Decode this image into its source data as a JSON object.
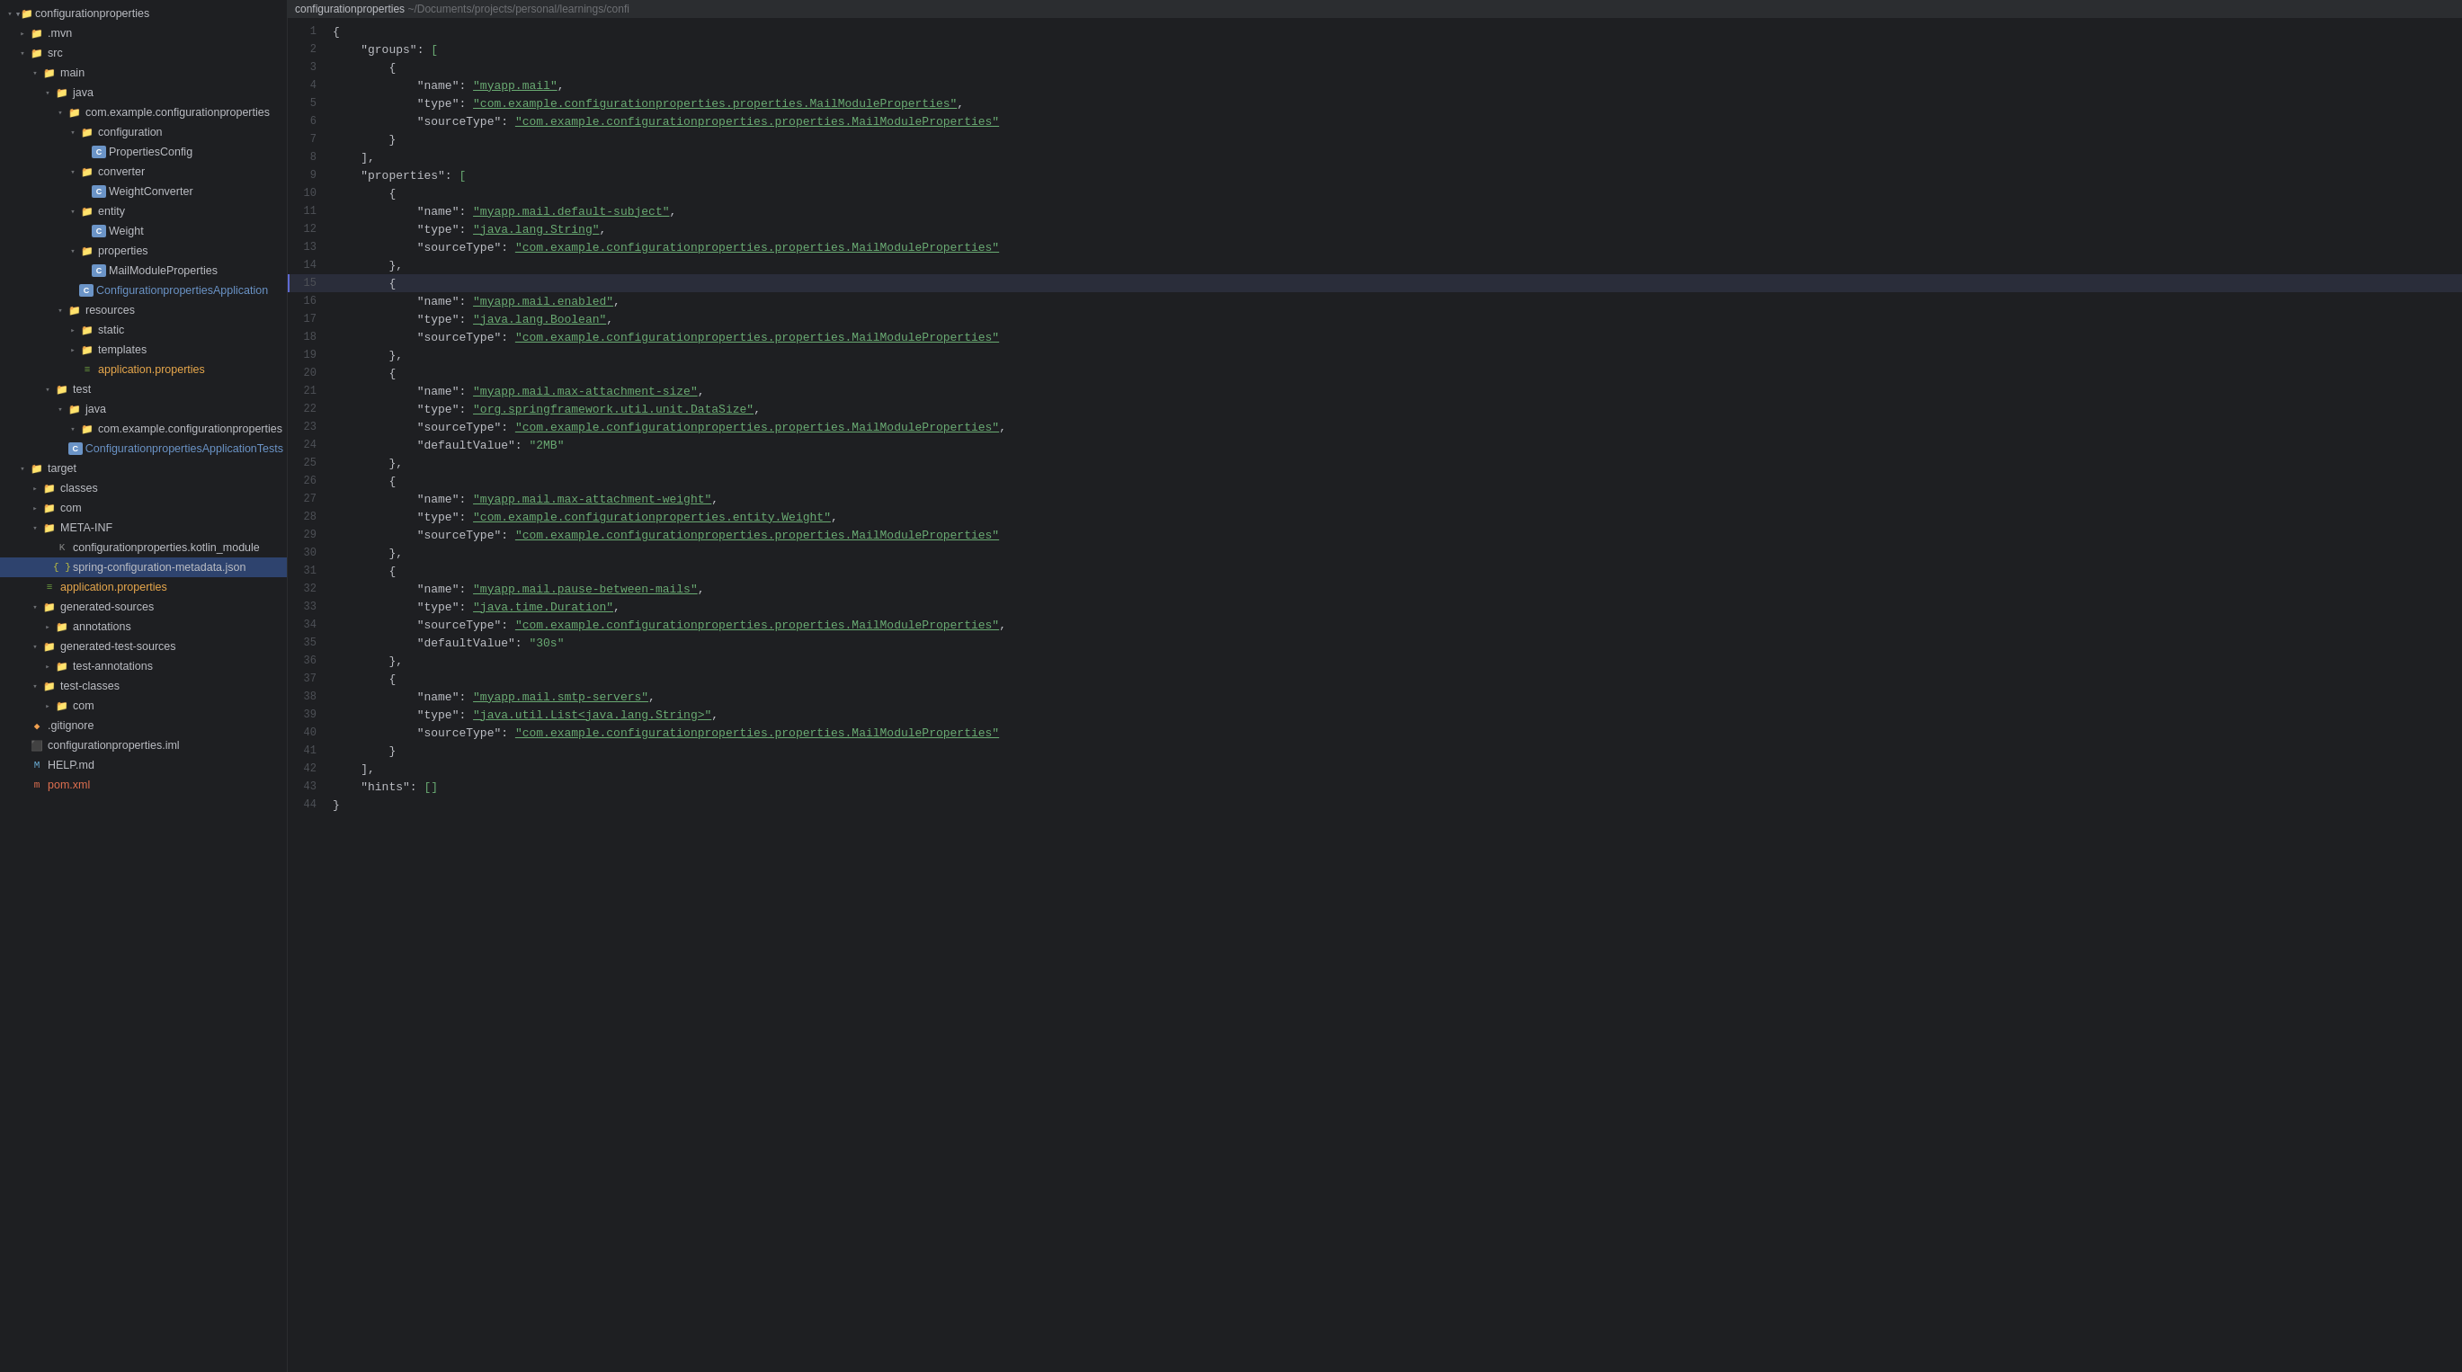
{
  "header": {
    "project_name": "configurationproperties",
    "path": " ~/Documents/projects/personal/learnings/confi"
  },
  "sidebar": {
    "items": [
      {
        "id": "root",
        "label": "configurationproperties",
        "type": "project-root",
        "indent": 0,
        "open": true,
        "icon": "folder"
      },
      {
        "id": "mvn",
        "label": ".mvn",
        "type": "folder",
        "indent": 1,
        "open": false,
        "icon": "folder"
      },
      {
        "id": "src",
        "label": "src",
        "type": "folder",
        "indent": 1,
        "open": true,
        "icon": "folder"
      },
      {
        "id": "main",
        "label": "main",
        "type": "folder",
        "indent": 2,
        "open": true,
        "icon": "folder"
      },
      {
        "id": "java",
        "label": "java",
        "type": "folder",
        "indent": 3,
        "open": true,
        "icon": "folder"
      },
      {
        "id": "com.example",
        "label": "com.example.configurationproperties",
        "type": "folder",
        "indent": 4,
        "open": true,
        "icon": "folder"
      },
      {
        "id": "configuration",
        "label": "configuration",
        "type": "folder",
        "indent": 5,
        "open": true,
        "icon": "folder"
      },
      {
        "id": "PropertiesConfig",
        "label": "PropertiesConfig",
        "type": "class",
        "indent": 6,
        "icon": "class"
      },
      {
        "id": "converter",
        "label": "converter",
        "type": "folder",
        "indent": 5,
        "open": true,
        "icon": "folder"
      },
      {
        "id": "WeightConverter",
        "label": "WeightConverter",
        "type": "class",
        "indent": 6,
        "icon": "class"
      },
      {
        "id": "entity",
        "label": "entity",
        "type": "folder",
        "indent": 5,
        "open": true,
        "icon": "folder"
      },
      {
        "id": "Weight",
        "label": "Weight",
        "type": "class",
        "indent": 6,
        "icon": "class"
      },
      {
        "id": "properties",
        "label": "properties",
        "type": "folder",
        "indent": 5,
        "open": true,
        "icon": "folder"
      },
      {
        "id": "MailModuleProperties",
        "label": "MailModuleProperties",
        "type": "class",
        "indent": 6,
        "icon": "class"
      },
      {
        "id": "ConfigApp",
        "label": "ConfigurationpropertiesApplication",
        "type": "class-main",
        "indent": 5,
        "icon": "class-main"
      },
      {
        "id": "resources",
        "label": "resources",
        "type": "folder",
        "indent": 4,
        "open": true,
        "icon": "folder"
      },
      {
        "id": "static",
        "label": "static",
        "type": "folder",
        "indent": 5,
        "open": false,
        "icon": "folder"
      },
      {
        "id": "templates",
        "label": "templates",
        "type": "folder",
        "indent": 5,
        "open": false,
        "icon": "folder"
      },
      {
        "id": "app-props",
        "label": "application.properties",
        "type": "properties",
        "indent": 5,
        "icon": "properties"
      },
      {
        "id": "test",
        "label": "test",
        "type": "folder",
        "indent": 3,
        "open": true,
        "icon": "folder"
      },
      {
        "id": "java-test",
        "label": "java",
        "type": "folder",
        "indent": 4,
        "open": true,
        "icon": "folder"
      },
      {
        "id": "com.example.test",
        "label": "com.example.configurationproperties",
        "type": "folder",
        "indent": 5,
        "open": true,
        "icon": "folder"
      },
      {
        "id": "AppTests",
        "label": "ConfigurationpropertiesApplicationTests",
        "type": "class-test",
        "indent": 6,
        "icon": "class-test"
      },
      {
        "id": "target",
        "label": "target",
        "type": "folder",
        "indent": 1,
        "open": true,
        "icon": "folder"
      },
      {
        "id": "classes",
        "label": "classes",
        "type": "folder",
        "indent": 2,
        "open": false,
        "icon": "folder"
      },
      {
        "id": "com-target",
        "label": "com",
        "type": "folder",
        "indent": 2,
        "open": false,
        "icon": "folder"
      },
      {
        "id": "META-INF",
        "label": "META-INF",
        "type": "folder",
        "indent": 2,
        "open": true,
        "icon": "folder"
      },
      {
        "id": "kotlin_module",
        "label": "configurationproperties.kotlin_module",
        "type": "kotlin",
        "indent": 3,
        "icon": "kotlin"
      },
      {
        "id": "spring-metadata",
        "label": "spring-configuration-metadata.json",
        "type": "json",
        "indent": 3,
        "icon": "json",
        "selected": true
      },
      {
        "id": "app-props2",
        "label": "application.properties",
        "type": "properties",
        "indent": 2,
        "icon": "properties"
      },
      {
        "id": "generated-sources",
        "label": "generated-sources",
        "type": "folder",
        "indent": 2,
        "open": true,
        "icon": "folder"
      },
      {
        "id": "annotations",
        "label": "annotations",
        "type": "folder",
        "indent": 3,
        "open": false,
        "icon": "folder"
      },
      {
        "id": "generated-test-sources",
        "label": "generated-test-sources",
        "type": "folder",
        "indent": 2,
        "open": true,
        "icon": "folder"
      },
      {
        "id": "test-annotations",
        "label": "test-annotations",
        "type": "folder",
        "indent": 3,
        "open": false,
        "icon": "folder"
      },
      {
        "id": "test-classes",
        "label": "test-classes",
        "type": "folder",
        "indent": 2,
        "open": true,
        "icon": "folder"
      },
      {
        "id": "com-test",
        "label": "com",
        "type": "folder",
        "indent": 3,
        "open": false,
        "icon": "folder"
      },
      {
        "id": "gitignore",
        "label": ".gitignore",
        "type": "gitignore",
        "indent": 1,
        "icon": "gitignore"
      },
      {
        "id": "iml",
        "label": "configurationproperties.iml",
        "type": "iml",
        "indent": 1,
        "icon": "iml"
      },
      {
        "id": "help",
        "label": "HELP.md",
        "type": "md",
        "indent": 1,
        "icon": "md"
      },
      {
        "id": "pom",
        "label": "pom.xml",
        "type": "xml",
        "indent": 1,
        "icon": "xml"
      }
    ]
  },
  "editor": {
    "filename": "spring-configuration-metadata.json",
    "lines": [
      {
        "num": 1,
        "content": "{",
        "highlighted": false
      },
      {
        "num": 2,
        "content": "    \"groups\": [",
        "highlighted": false
      },
      {
        "num": 3,
        "content": "        {",
        "highlighted": false
      },
      {
        "num": 4,
        "content": "            \"name\": \"myapp.mail\",",
        "highlighted": false
      },
      {
        "num": 5,
        "content": "            \"type\": \"com.example.configurationproperties.properties.MailModuleProperties\",",
        "highlighted": false
      },
      {
        "num": 6,
        "content": "            \"sourceType\": \"com.example.configurationproperties.properties.MailModuleProperties\"",
        "highlighted": false
      },
      {
        "num": 7,
        "content": "        }",
        "highlighted": false
      },
      {
        "num": 8,
        "content": "    ],",
        "highlighted": false
      },
      {
        "num": 9,
        "content": "    \"properties\": [",
        "highlighted": false
      },
      {
        "num": 10,
        "content": "        {",
        "highlighted": false
      },
      {
        "num": 11,
        "content": "            \"name\": \"myapp.mail.default-subject\",",
        "highlighted": false
      },
      {
        "num": 12,
        "content": "            \"type\": \"java.lang.String\",",
        "highlighted": false
      },
      {
        "num": 13,
        "content": "            \"sourceType\": \"com.example.configurationproperties.properties.MailModuleProperties\"",
        "highlighted": false
      },
      {
        "num": 14,
        "content": "        },",
        "highlighted": false
      },
      {
        "num": 15,
        "content": "        {",
        "highlighted": true
      },
      {
        "num": 16,
        "content": "            \"name\": \"myapp.mail.enabled\",",
        "highlighted": false
      },
      {
        "num": 17,
        "content": "            \"type\": \"java.lang.Boolean\",",
        "highlighted": false
      },
      {
        "num": 18,
        "content": "            \"sourceType\": \"com.example.configurationproperties.properties.MailModuleProperties\"",
        "highlighted": false
      },
      {
        "num": 19,
        "content": "        },",
        "highlighted": false
      },
      {
        "num": 20,
        "content": "        {",
        "highlighted": false
      },
      {
        "num": 21,
        "content": "            \"name\": \"myapp.mail.max-attachment-size\",",
        "highlighted": false
      },
      {
        "num": 22,
        "content": "            \"type\": \"org.springframework.util.unit.DataSize\",",
        "highlighted": false
      },
      {
        "num": 23,
        "content": "            \"sourceType\": \"com.example.configurationproperties.properties.MailModuleProperties\",",
        "highlighted": false
      },
      {
        "num": 24,
        "content": "            \"defaultValue\": \"2MB\"",
        "highlighted": false
      },
      {
        "num": 25,
        "content": "        },",
        "highlighted": false
      },
      {
        "num": 26,
        "content": "        {",
        "highlighted": false
      },
      {
        "num": 27,
        "content": "            \"name\": \"myapp.mail.max-attachment-weight\",",
        "highlighted": false
      },
      {
        "num": 28,
        "content": "            \"type\": \"com.example.configurationproperties.entity.Weight\",",
        "highlighted": false
      },
      {
        "num": 29,
        "content": "            \"sourceType\": \"com.example.configurationproperties.properties.MailModuleProperties\"",
        "highlighted": false
      },
      {
        "num": 30,
        "content": "        },",
        "highlighted": false
      },
      {
        "num": 31,
        "content": "        {",
        "highlighted": false
      },
      {
        "num": 32,
        "content": "            \"name\": \"myapp.mail.pause-between-mails\",",
        "highlighted": false
      },
      {
        "num": 33,
        "content": "            \"type\": \"java.time.Duration\",",
        "highlighted": false
      },
      {
        "num": 34,
        "content": "            \"sourceType\": \"com.example.configurationproperties.properties.MailModuleProperties\",",
        "highlighted": false
      },
      {
        "num": 35,
        "content": "            \"defaultValue\": \"30s\"",
        "highlighted": false
      },
      {
        "num": 36,
        "content": "        },",
        "highlighted": false
      },
      {
        "num": 37,
        "content": "        {",
        "highlighted": false
      },
      {
        "num": 38,
        "content": "            \"name\": \"myapp.mail.smtp-servers\",",
        "highlighted": false
      },
      {
        "num": 39,
        "content": "            \"type\": \"java.util.List<java.lang.String>\",",
        "highlighted": false
      },
      {
        "num": 40,
        "content": "            \"sourceType\": \"com.example.configurationproperties.properties.MailModuleProperties\"",
        "highlighted": false
      },
      {
        "num": 41,
        "content": "        }",
        "highlighted": false
      },
      {
        "num": 42,
        "content": "    ],",
        "highlighted": false
      },
      {
        "num": 43,
        "content": "    \"hints\": []",
        "highlighted": false
      },
      {
        "num": 44,
        "content": "}",
        "highlighted": false
      }
    ]
  },
  "icons": {
    "chevron_open": "▾",
    "chevron_closed": "▸",
    "folder": "📁",
    "folder_closed": "📁"
  }
}
